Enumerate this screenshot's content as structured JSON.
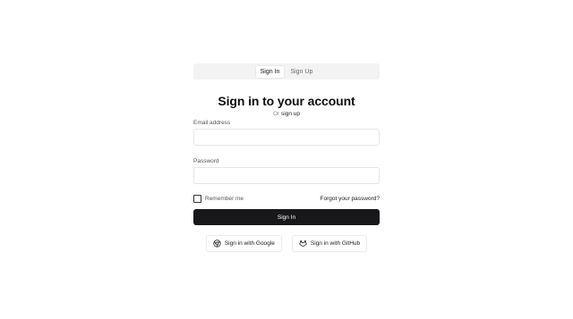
{
  "tabs": [
    {
      "label": "Sign In",
      "active": true
    },
    {
      "label": "Sign Up",
      "active": false
    }
  ],
  "heading": "Sign in to your account",
  "alt_prompt": {
    "prefix": "Or",
    "link": "sign up"
  },
  "email": {
    "label": "Email address",
    "value": "",
    "placeholder": ""
  },
  "password": {
    "label": "Password",
    "value": "",
    "placeholder": ""
  },
  "remember": {
    "label": "Remember me",
    "checked": false
  },
  "forgot_label": "Forgot your password?",
  "submit_label": "Sign In",
  "social": {
    "google": {
      "label": "Sign in with Google",
      "icon": "chrome-icon"
    },
    "github": {
      "label": "Sign in with GitHub",
      "icon": "gitlab-icon"
    }
  },
  "colors": {
    "primary_button": "#18181b",
    "tab_bar": "#f3f3f4",
    "input_border": "#e6e6e8"
  }
}
